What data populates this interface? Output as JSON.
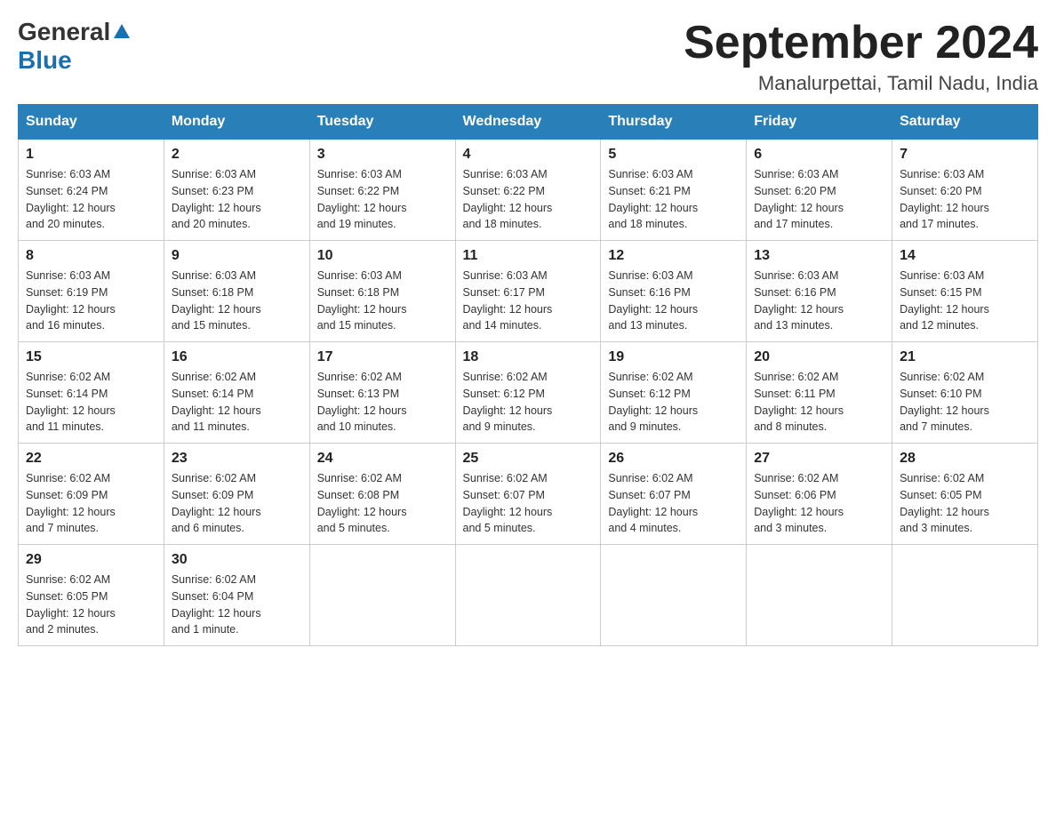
{
  "header": {
    "logo_line1": "General",
    "logo_line2": "Blue",
    "month_title": "September 2024",
    "location": "Manalurpettai, Tamil Nadu, India"
  },
  "weekdays": [
    "Sunday",
    "Monday",
    "Tuesday",
    "Wednesday",
    "Thursday",
    "Friday",
    "Saturday"
  ],
  "weeks": [
    [
      {
        "day": "1",
        "sunrise": "6:03 AM",
        "sunset": "6:24 PM",
        "daylight": "12 hours and 20 minutes."
      },
      {
        "day": "2",
        "sunrise": "6:03 AM",
        "sunset": "6:23 PM",
        "daylight": "12 hours and 20 minutes."
      },
      {
        "day": "3",
        "sunrise": "6:03 AM",
        "sunset": "6:22 PM",
        "daylight": "12 hours and 19 minutes."
      },
      {
        "day": "4",
        "sunrise": "6:03 AM",
        "sunset": "6:22 PM",
        "daylight": "12 hours and 18 minutes."
      },
      {
        "day": "5",
        "sunrise": "6:03 AM",
        "sunset": "6:21 PM",
        "daylight": "12 hours and 18 minutes."
      },
      {
        "day": "6",
        "sunrise": "6:03 AM",
        "sunset": "6:20 PM",
        "daylight": "12 hours and 17 minutes."
      },
      {
        "day": "7",
        "sunrise": "6:03 AM",
        "sunset": "6:20 PM",
        "daylight": "12 hours and 17 minutes."
      }
    ],
    [
      {
        "day": "8",
        "sunrise": "6:03 AM",
        "sunset": "6:19 PM",
        "daylight": "12 hours and 16 minutes."
      },
      {
        "day": "9",
        "sunrise": "6:03 AM",
        "sunset": "6:18 PM",
        "daylight": "12 hours and 15 minutes."
      },
      {
        "day": "10",
        "sunrise": "6:03 AM",
        "sunset": "6:18 PM",
        "daylight": "12 hours and 15 minutes."
      },
      {
        "day": "11",
        "sunrise": "6:03 AM",
        "sunset": "6:17 PM",
        "daylight": "12 hours and 14 minutes."
      },
      {
        "day": "12",
        "sunrise": "6:03 AM",
        "sunset": "6:16 PM",
        "daylight": "12 hours and 13 minutes."
      },
      {
        "day": "13",
        "sunrise": "6:03 AM",
        "sunset": "6:16 PM",
        "daylight": "12 hours and 13 minutes."
      },
      {
        "day": "14",
        "sunrise": "6:03 AM",
        "sunset": "6:15 PM",
        "daylight": "12 hours and 12 minutes."
      }
    ],
    [
      {
        "day": "15",
        "sunrise": "6:02 AM",
        "sunset": "6:14 PM",
        "daylight": "12 hours and 11 minutes."
      },
      {
        "day": "16",
        "sunrise": "6:02 AM",
        "sunset": "6:14 PM",
        "daylight": "12 hours and 11 minutes."
      },
      {
        "day": "17",
        "sunrise": "6:02 AM",
        "sunset": "6:13 PM",
        "daylight": "12 hours and 10 minutes."
      },
      {
        "day": "18",
        "sunrise": "6:02 AM",
        "sunset": "6:12 PM",
        "daylight": "12 hours and 9 minutes."
      },
      {
        "day": "19",
        "sunrise": "6:02 AM",
        "sunset": "6:12 PM",
        "daylight": "12 hours and 9 minutes."
      },
      {
        "day": "20",
        "sunrise": "6:02 AM",
        "sunset": "6:11 PM",
        "daylight": "12 hours and 8 minutes."
      },
      {
        "day": "21",
        "sunrise": "6:02 AM",
        "sunset": "6:10 PM",
        "daylight": "12 hours and 7 minutes."
      }
    ],
    [
      {
        "day": "22",
        "sunrise": "6:02 AM",
        "sunset": "6:09 PM",
        "daylight": "12 hours and 7 minutes."
      },
      {
        "day": "23",
        "sunrise": "6:02 AM",
        "sunset": "6:09 PM",
        "daylight": "12 hours and 6 minutes."
      },
      {
        "day": "24",
        "sunrise": "6:02 AM",
        "sunset": "6:08 PM",
        "daylight": "12 hours and 5 minutes."
      },
      {
        "day": "25",
        "sunrise": "6:02 AM",
        "sunset": "6:07 PM",
        "daylight": "12 hours and 5 minutes."
      },
      {
        "day": "26",
        "sunrise": "6:02 AM",
        "sunset": "6:07 PM",
        "daylight": "12 hours and 4 minutes."
      },
      {
        "day": "27",
        "sunrise": "6:02 AM",
        "sunset": "6:06 PM",
        "daylight": "12 hours and 3 minutes."
      },
      {
        "day": "28",
        "sunrise": "6:02 AM",
        "sunset": "6:05 PM",
        "daylight": "12 hours and 3 minutes."
      }
    ],
    [
      {
        "day": "29",
        "sunrise": "6:02 AM",
        "sunset": "6:05 PM",
        "daylight": "12 hours and 2 minutes."
      },
      {
        "day": "30",
        "sunrise": "6:02 AM",
        "sunset": "6:04 PM",
        "daylight": "12 hours and 1 minute."
      },
      null,
      null,
      null,
      null,
      null
    ]
  ],
  "labels": {
    "sunrise_prefix": "Sunrise: ",
    "sunset_prefix": "Sunset: ",
    "daylight_prefix": "Daylight: "
  }
}
